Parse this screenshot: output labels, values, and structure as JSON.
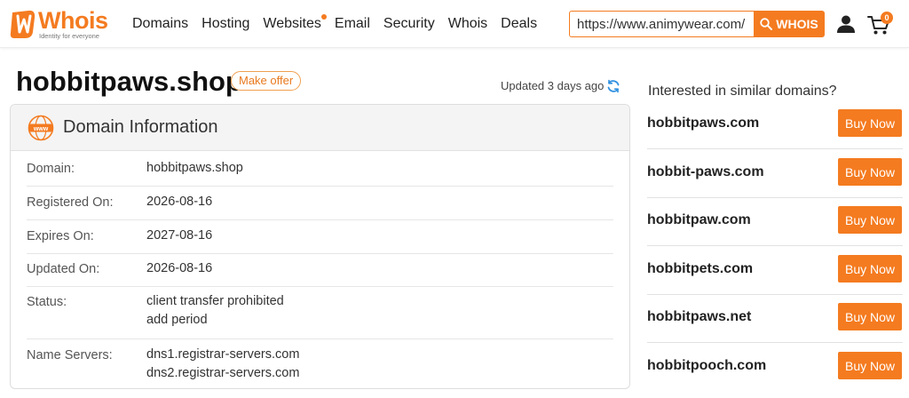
{
  "header": {
    "logo_text": "Whois",
    "logo_tagline": "Identity for everyone",
    "nav": [
      {
        "label": "Domains"
      },
      {
        "label": "Hosting"
      },
      {
        "label": "Websites"
      },
      {
        "label": "Email"
      },
      {
        "label": "Security"
      },
      {
        "label": "Whois"
      },
      {
        "label": "Deals"
      }
    ],
    "search_value": "https://www.animywear.com/",
    "search_button": "WHOIS",
    "cart_count": "0",
    "accent": "#f47b20"
  },
  "domain": {
    "name": "hobbitpaws.shop",
    "make_offer": "Make offer",
    "updated": "Updated 3 days ago"
  },
  "info": {
    "title": "Domain Information",
    "rows": [
      {
        "label": "Domain:",
        "values": [
          "hobbitpaws.shop"
        ]
      },
      {
        "label": "Registered On:",
        "values": [
          "2026-08-16"
        ]
      },
      {
        "label": "Expires On:",
        "values": [
          "2027-08-16"
        ]
      },
      {
        "label": "Updated On:",
        "values": [
          "2026-08-16"
        ]
      },
      {
        "label": "Status:",
        "values": [
          "client transfer prohibited",
          "add period"
        ]
      },
      {
        "label": "Name Servers:",
        "values": [
          "dns1.registrar-servers.com",
          "dns2.registrar-servers.com"
        ]
      }
    ]
  },
  "similar": {
    "heading": "Interested in similar domains?",
    "button_label": "Buy Now",
    "domains": [
      {
        "name": "hobbitpaws.com"
      },
      {
        "name": "hobbit-paws.com"
      },
      {
        "name": "hobbitpaw.com"
      },
      {
        "name": "hobbitpets.com"
      },
      {
        "name": "hobbitpaws.net"
      },
      {
        "name": "hobbitpooch.com"
      }
    ]
  }
}
